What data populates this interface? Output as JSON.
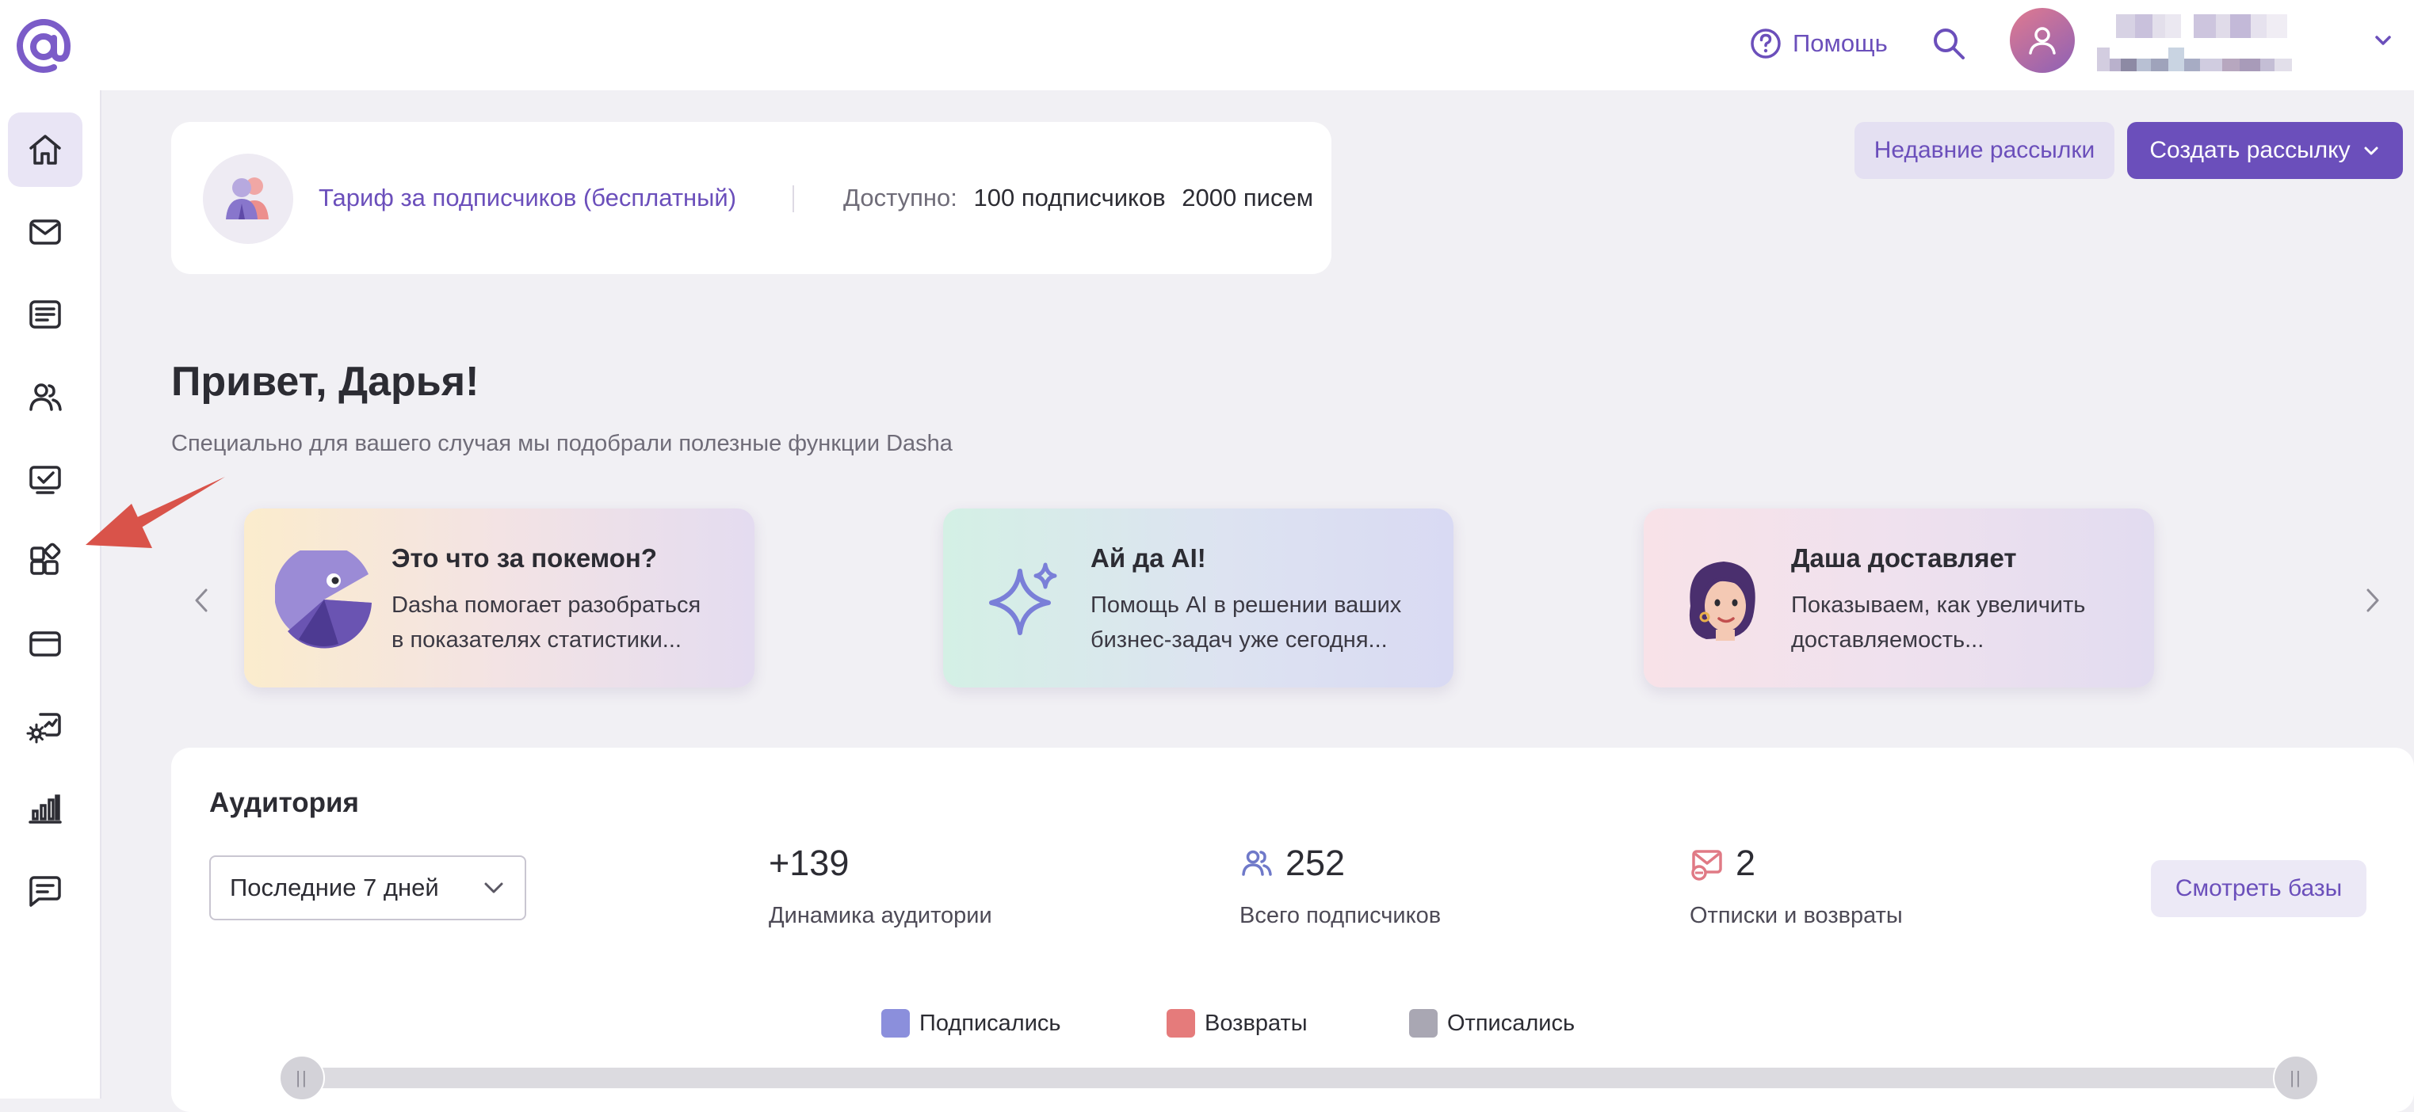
{
  "header": {
    "help_label": "Помощь"
  },
  "tariff": {
    "name": "Тариф за подписчиков (бесплатный)",
    "available_label": "Доступно:",
    "subscribers_count": "100",
    "subscribers_label": "подписчиков",
    "letters_count": "2000",
    "letters_label": "писем"
  },
  "actions": {
    "recent_label": "Недавние рассылки",
    "create_label": "Создать рассылку"
  },
  "greeting": {
    "title": "Привет, Дарья!",
    "subtitle": "Специально для вашего случая мы подобрали полезные функции Dasha"
  },
  "promo_cards": [
    {
      "title": "Это что за покемон?",
      "line1": "Dasha помогает разобраться",
      "line2": "в показателях статистики..."
    },
    {
      "title": "Ай да AI!",
      "line1": "Помощь AI в решении ваших",
      "line2": "бизнес-задач уже сегодня..."
    },
    {
      "title": "Даша доставляет",
      "line1": "Показываем, как увеличить",
      "line2": "доставляемость..."
    }
  ],
  "audience": {
    "title": "Аудитория",
    "period": "Последние 7 дней",
    "stats": [
      {
        "value": "+139",
        "label": "Динамика аудитории"
      },
      {
        "value": "252",
        "label": "Всего подписчиков"
      },
      {
        "value": "2",
        "label": "Отписки и возвраты"
      }
    ],
    "view_bases_label": "Смотреть базы",
    "legend": [
      {
        "label": "Подписались",
        "color": "#8b8fdc"
      },
      {
        "label": "Возвраты",
        "color": "#e57b7b"
      },
      {
        "label": "Отписались",
        "color": "#a9a7b3"
      }
    ]
  },
  "colors": {
    "accent": "#6b4fbb",
    "sidebar_active_bg": "#e9e5f5",
    "pointer_arrow": "#d9534a"
  }
}
